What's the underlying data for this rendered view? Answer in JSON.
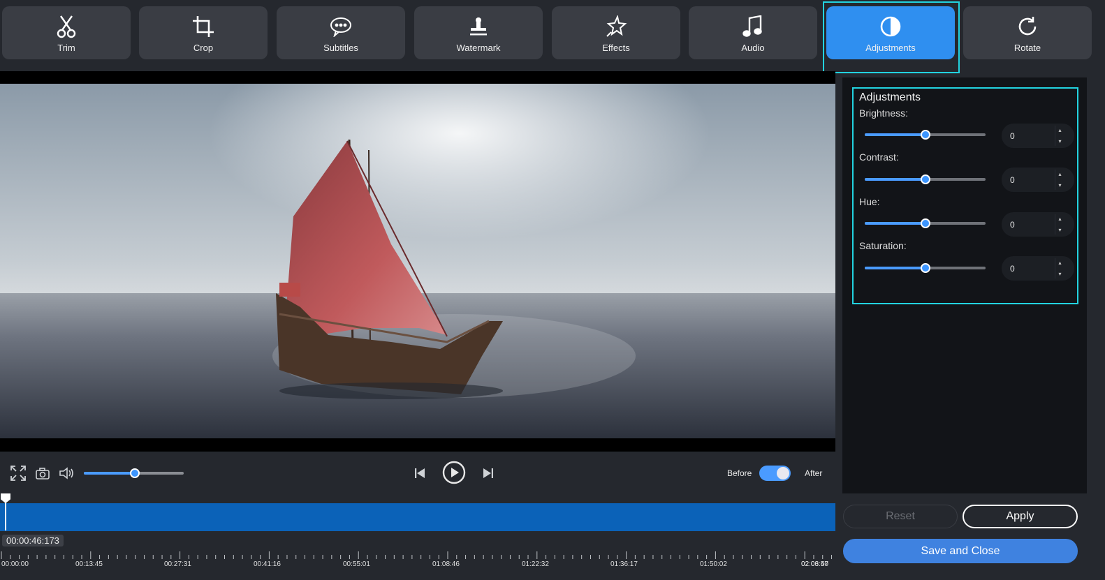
{
  "toolbar": {
    "tools": [
      {
        "label": "Trim",
        "icon": "scissors-icon"
      },
      {
        "label": "Crop",
        "icon": "crop-icon"
      },
      {
        "label": "Subtitles",
        "icon": "speech-bubble-icon"
      },
      {
        "label": "Watermark",
        "icon": "stamp-icon"
      },
      {
        "label": "Effects",
        "icon": "sparkle-star-icon"
      },
      {
        "label": "Audio",
        "icon": "music-note-icon"
      },
      {
        "label": "Adjustments",
        "icon": "contrast-circle-icon"
      },
      {
        "label": "Rotate",
        "icon": "rotate-icon"
      }
    ],
    "active": "Adjustments",
    "active_color": "#2f8ff0",
    "highlight_color": "#22d3e0"
  },
  "player": {
    "volume_level": 0.51,
    "before_label": "Before",
    "after_label": "After",
    "toggle_on": true
  },
  "timeline": {
    "current_time": "00:00:46:173",
    "progress_fraction": 0.006,
    "ticks": [
      "00:00:00",
      "00:13:45",
      "00:27:31",
      "00:41:16",
      "00:55:01",
      "01:08:46",
      "01:22:32",
      "01:36:17",
      "01:50:02",
      "02:03:47",
      "02:06:50"
    ],
    "bar_color": "#0b62b8"
  },
  "adjustments": {
    "title": "Adjustments",
    "params": [
      {
        "label": "Brightness:",
        "value": "0",
        "level": 0.5
      },
      {
        "label": "Contrast:",
        "value": "0",
        "level": 0.5
      },
      {
        "label": "Hue:",
        "value": "0",
        "level": 0.5
      },
      {
        "label": "Saturation:",
        "value": "0",
        "level": 0.5
      }
    ]
  },
  "buttons": {
    "reset": "Reset",
    "apply": "Apply",
    "save": "Save and Close"
  }
}
